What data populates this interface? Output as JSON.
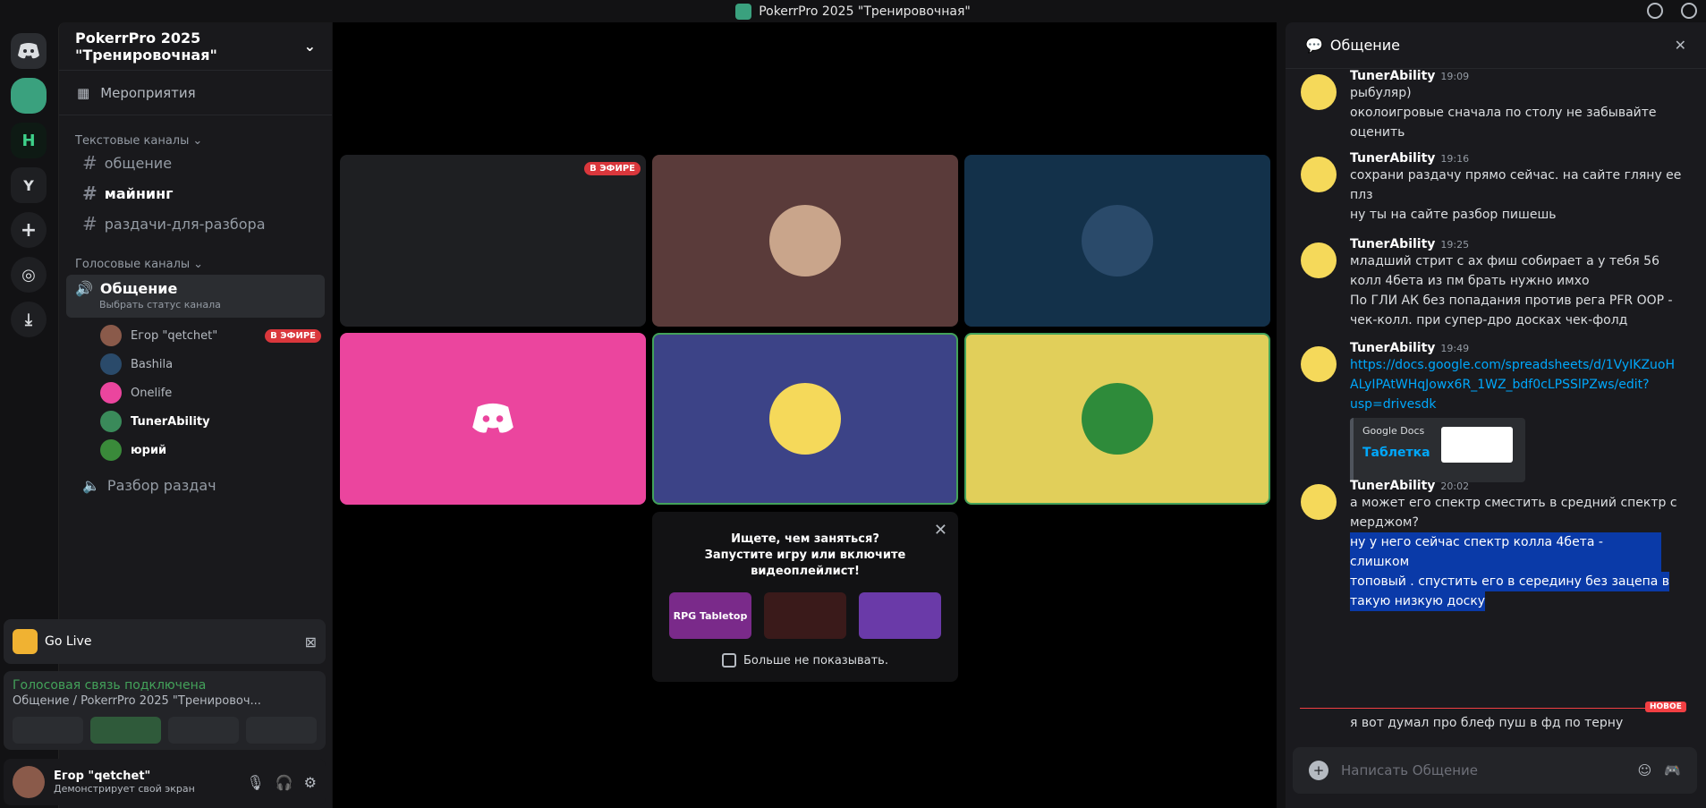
{
  "window": {
    "title": "PokerrPro 2025 \"Тренировочная\""
  },
  "guilds": {
    "y_label": "Y"
  },
  "sidebar": {
    "server_name": "PokerrPro 2025 \"Тренировочная\"",
    "events_label": "Мероприятия",
    "text_category": "Текстовые каналы",
    "text_channels": [
      {
        "name": "общение"
      },
      {
        "name": "майнинг"
      },
      {
        "name": "раздачи-для-разбора"
      }
    ],
    "voice_category": "Голосовые каналы",
    "voice_channel_active": "Общение",
    "voice_channel_status": "Выбрать статус канала",
    "voice_users": [
      {
        "name": "Егор \"qetchet\"",
        "badge": "В ЭФИРЕ"
      },
      {
        "name": "Bashila"
      },
      {
        "name": "Onelife"
      },
      {
        "name": "TunerAbility"
      },
      {
        "name": "юрий"
      }
    ],
    "voice_channel_other": "Разбор раздач"
  },
  "go_live": {
    "label": "Go Live"
  },
  "voice_status": {
    "connected": "Голосовая связь подключена",
    "location": "Общение / PokerrPro 2025 \"Тренировоч..."
  },
  "user_panel": {
    "name": "Егор \"qetchet\"",
    "status": "Демонстрирует свой экран"
  },
  "stage": {
    "live_badge": "В ЭФИРЕ",
    "tiles": [
      "stream",
      "spiderman",
      "subzero",
      "discord",
      "blue-robot",
      "kuban"
    ],
    "activity_prompt": "Ищете, чем заняться? Запустите игру или включите видеоплейлист!",
    "activity_cards": [
      "RPG Tabletop",
      "",
      ""
    ],
    "dont_show_label": "Больше не показывать."
  },
  "chat": {
    "title": "Общение",
    "messages": [
      {
        "author": "TunerAbility",
        "time": "19:09",
        "lines": [
          "рыбуляр)",
          "околоигровые сначала по столу не забывайте",
          "оценить"
        ]
      },
      {
        "author": "TunerAbility",
        "time": "19:16",
        "lines": [
          "сохрани раздачу прямо сейчас. на сайте гляну ее",
          "плз",
          "ну ты на сайте разбор пишешь"
        ]
      },
      {
        "author": "TunerAbility",
        "time": "19:25",
        "lines": [
          "младший стрит с ах фиш собирает а у тебя 56",
          "колл 4бета из пм брать нужно имхо",
          "По ГЛИ АК без попадания против рега PFR OOP -",
          "чек-колл. при  супер-дро досках чек-фолд"
        ]
      },
      {
        "author": "TunerAbility",
        "time": "19:49",
        "lines": [
          "https://docs.google.com/spreadsheets/d/1VyIKZuoH",
          "ALyIPAtWHqJowx6R_1WZ_bdf0cLPSSlPZws/edit?",
          "usp=drivesdk"
        ]
      },
      {
        "author": "TunerAbility",
        "time": "20:02",
        "lines": [
          "а может его спектр сместить в средний спектр с",
          "мерджом?"
        ]
      }
    ],
    "embed": {
      "provider": "Google Docs",
      "title": "Таблетка"
    },
    "highlighted": [
      "ну у него сейчас спектр колла 4бета - слишком",
      "топовый . спустить его в середину без зацепа в",
      "такую низкую доску"
    ],
    "new_label": "НОВОЕ",
    "last_line": "я вот думал про блеф пуш в фд по терну",
    "input_placeholder": "Написать Общение"
  }
}
